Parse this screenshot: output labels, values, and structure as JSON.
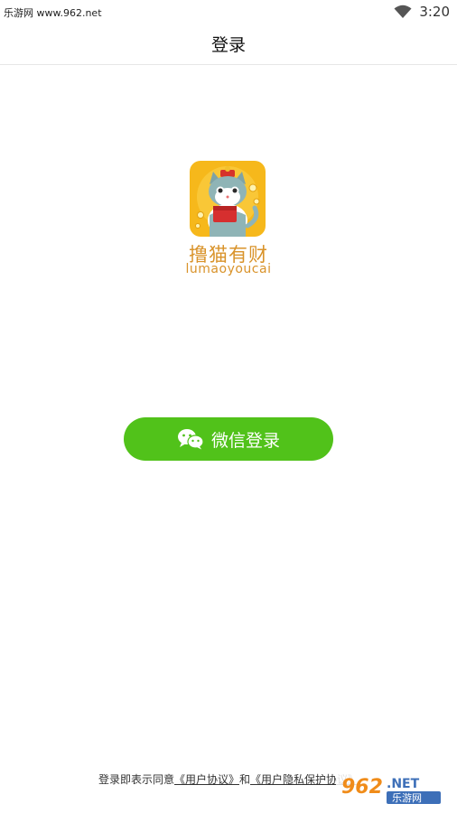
{
  "status_bar": {
    "watermark": "乐游网 www.962.net",
    "time": "3:20"
  },
  "header": {
    "title": "登录"
  },
  "brand": {
    "name": "撸猫有财",
    "subtitle": "lumaoyoucai"
  },
  "login": {
    "wechat_button_label": "微信登录"
  },
  "agreement": {
    "prefix": "登录即表示同意",
    "user_agreement": "《用户协议》",
    "conjunction": "和",
    "privacy_policy": "《用户隐私保护协议》"
  },
  "watermark_badge": {
    "number": "962",
    "tld": ".NET",
    "name": "乐游网"
  },
  "colors": {
    "accent_green": "#51c21a",
    "brand_orange": "#d9932a",
    "logo_bg": "#f6b81b"
  }
}
